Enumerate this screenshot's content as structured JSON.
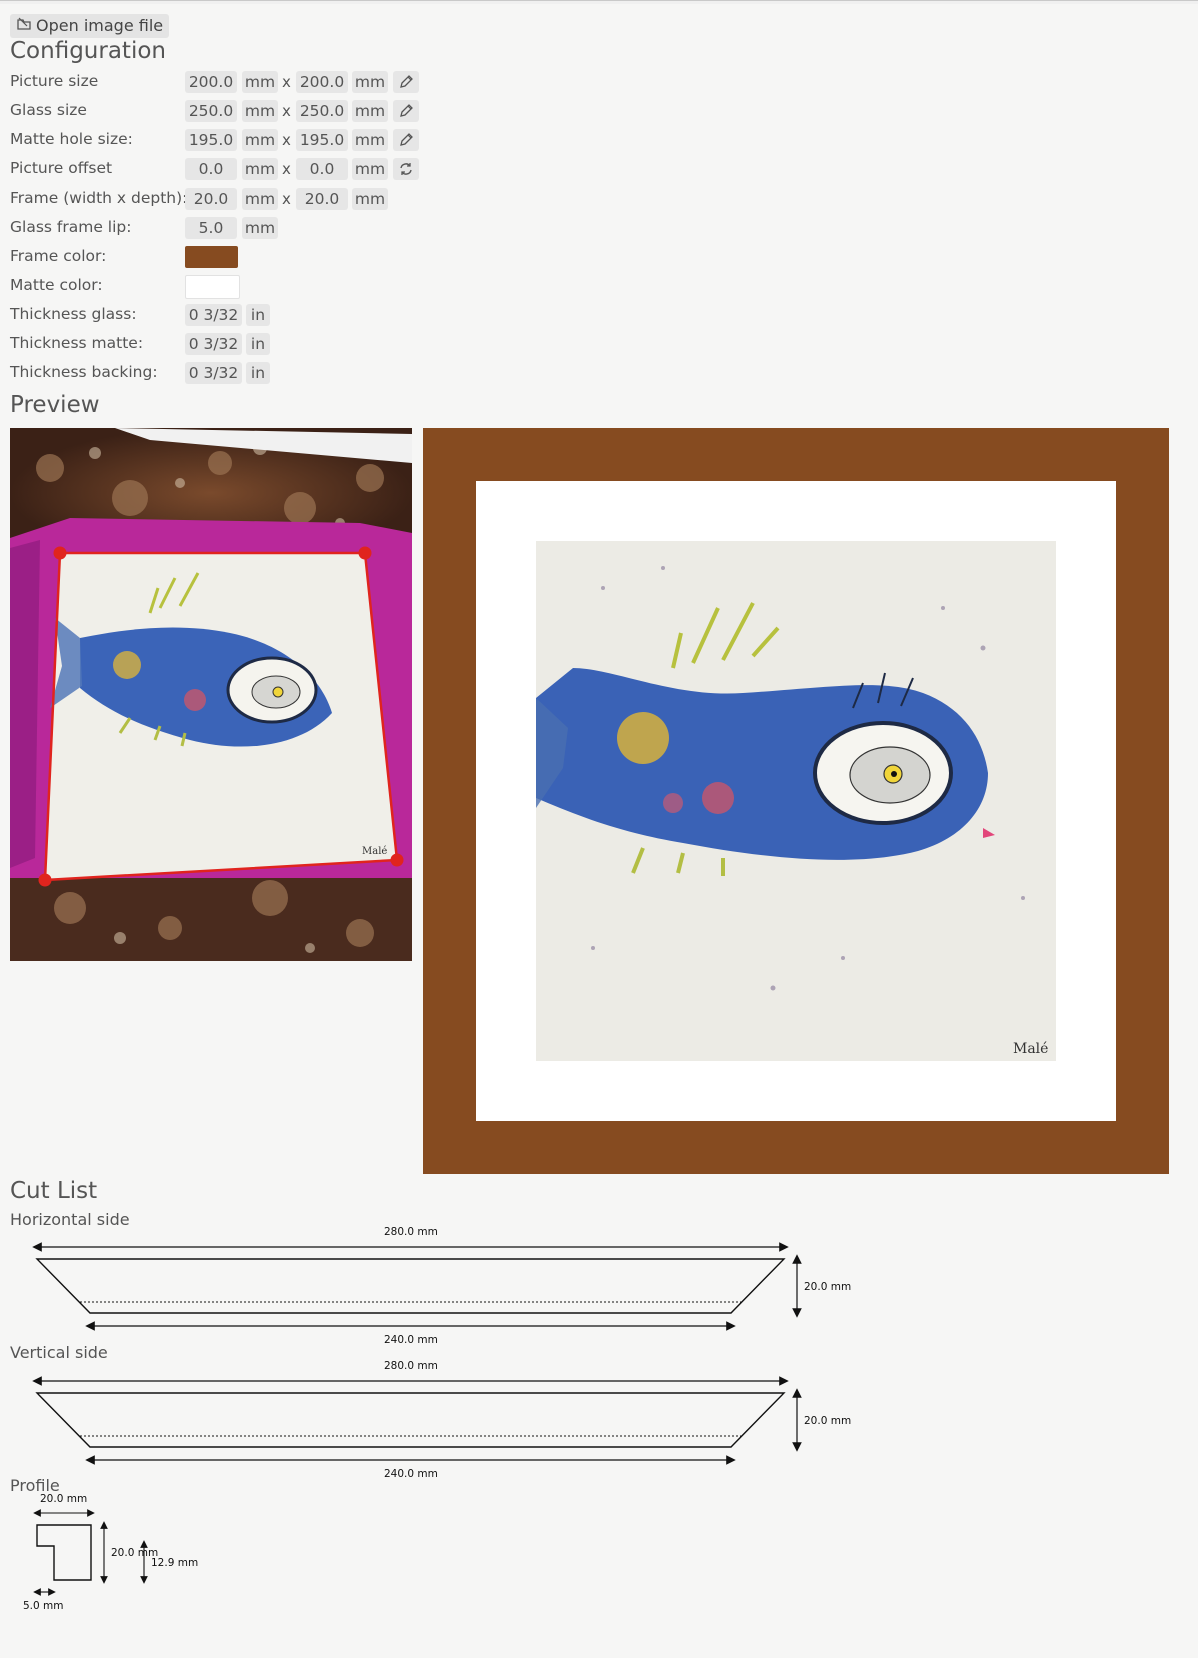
{
  "toolbar": {
    "open_label": "Open image file",
    "open_icon": "image-file-icon"
  },
  "config": {
    "title": "Configuration",
    "rows": {
      "picture_size": {
        "label": "Picture size",
        "w": "200.0",
        "h": "200.0",
        "unit": "mm",
        "x": "x"
      },
      "glass_size": {
        "label": "Glass size",
        "w": "250.0",
        "h": "250.0",
        "unit": "mm",
        "x": "x"
      },
      "matte_hole": {
        "label": "Matte hole size:",
        "w": "195.0",
        "h": "195.0",
        "unit": "mm",
        "x": "x"
      },
      "picture_offset": {
        "label": "Picture offset",
        "w": "0.0",
        "h": "0.0",
        "unit": "mm",
        "x": "x"
      },
      "frame": {
        "label": "Frame (width x depth):",
        "w": "20.0",
        "h": "20.0",
        "unit": "mm",
        "x": "x"
      },
      "lip": {
        "label": "Glass frame lip:",
        "v": "5.0",
        "unit": "mm"
      },
      "frame_color": {
        "label": "Frame color:",
        "color": "#864b20"
      },
      "matte_color": {
        "label": "Matte color:",
        "color": "#ffffff"
      },
      "thick_glass": {
        "label": "Thickness glass:",
        "v": "0 3/32",
        "unit": "in"
      },
      "thick_matte": {
        "label": "Thickness matte:",
        "v": "0 3/32",
        "unit": "in"
      },
      "thick_backing": {
        "label": "Thickness backing:",
        "v": "0 3/32",
        "unit": "in"
      }
    }
  },
  "preview": {
    "title": "Preview",
    "signature": "Malé"
  },
  "cutlist": {
    "title": "Cut List",
    "horizontal": {
      "label": "Horizontal side",
      "outer": "280.0 mm",
      "inner": "240.0 mm",
      "depth": "20.0 mm"
    },
    "vertical": {
      "label": "Vertical side",
      "outer": "280.0 mm",
      "inner": "240.0 mm",
      "depth": "20.0 mm"
    },
    "profile": {
      "label": "Profile",
      "width": "20.0 mm",
      "depth": "20.0 mm",
      "rabbet": "12.9 mm",
      "lip": "5.0 mm"
    }
  }
}
